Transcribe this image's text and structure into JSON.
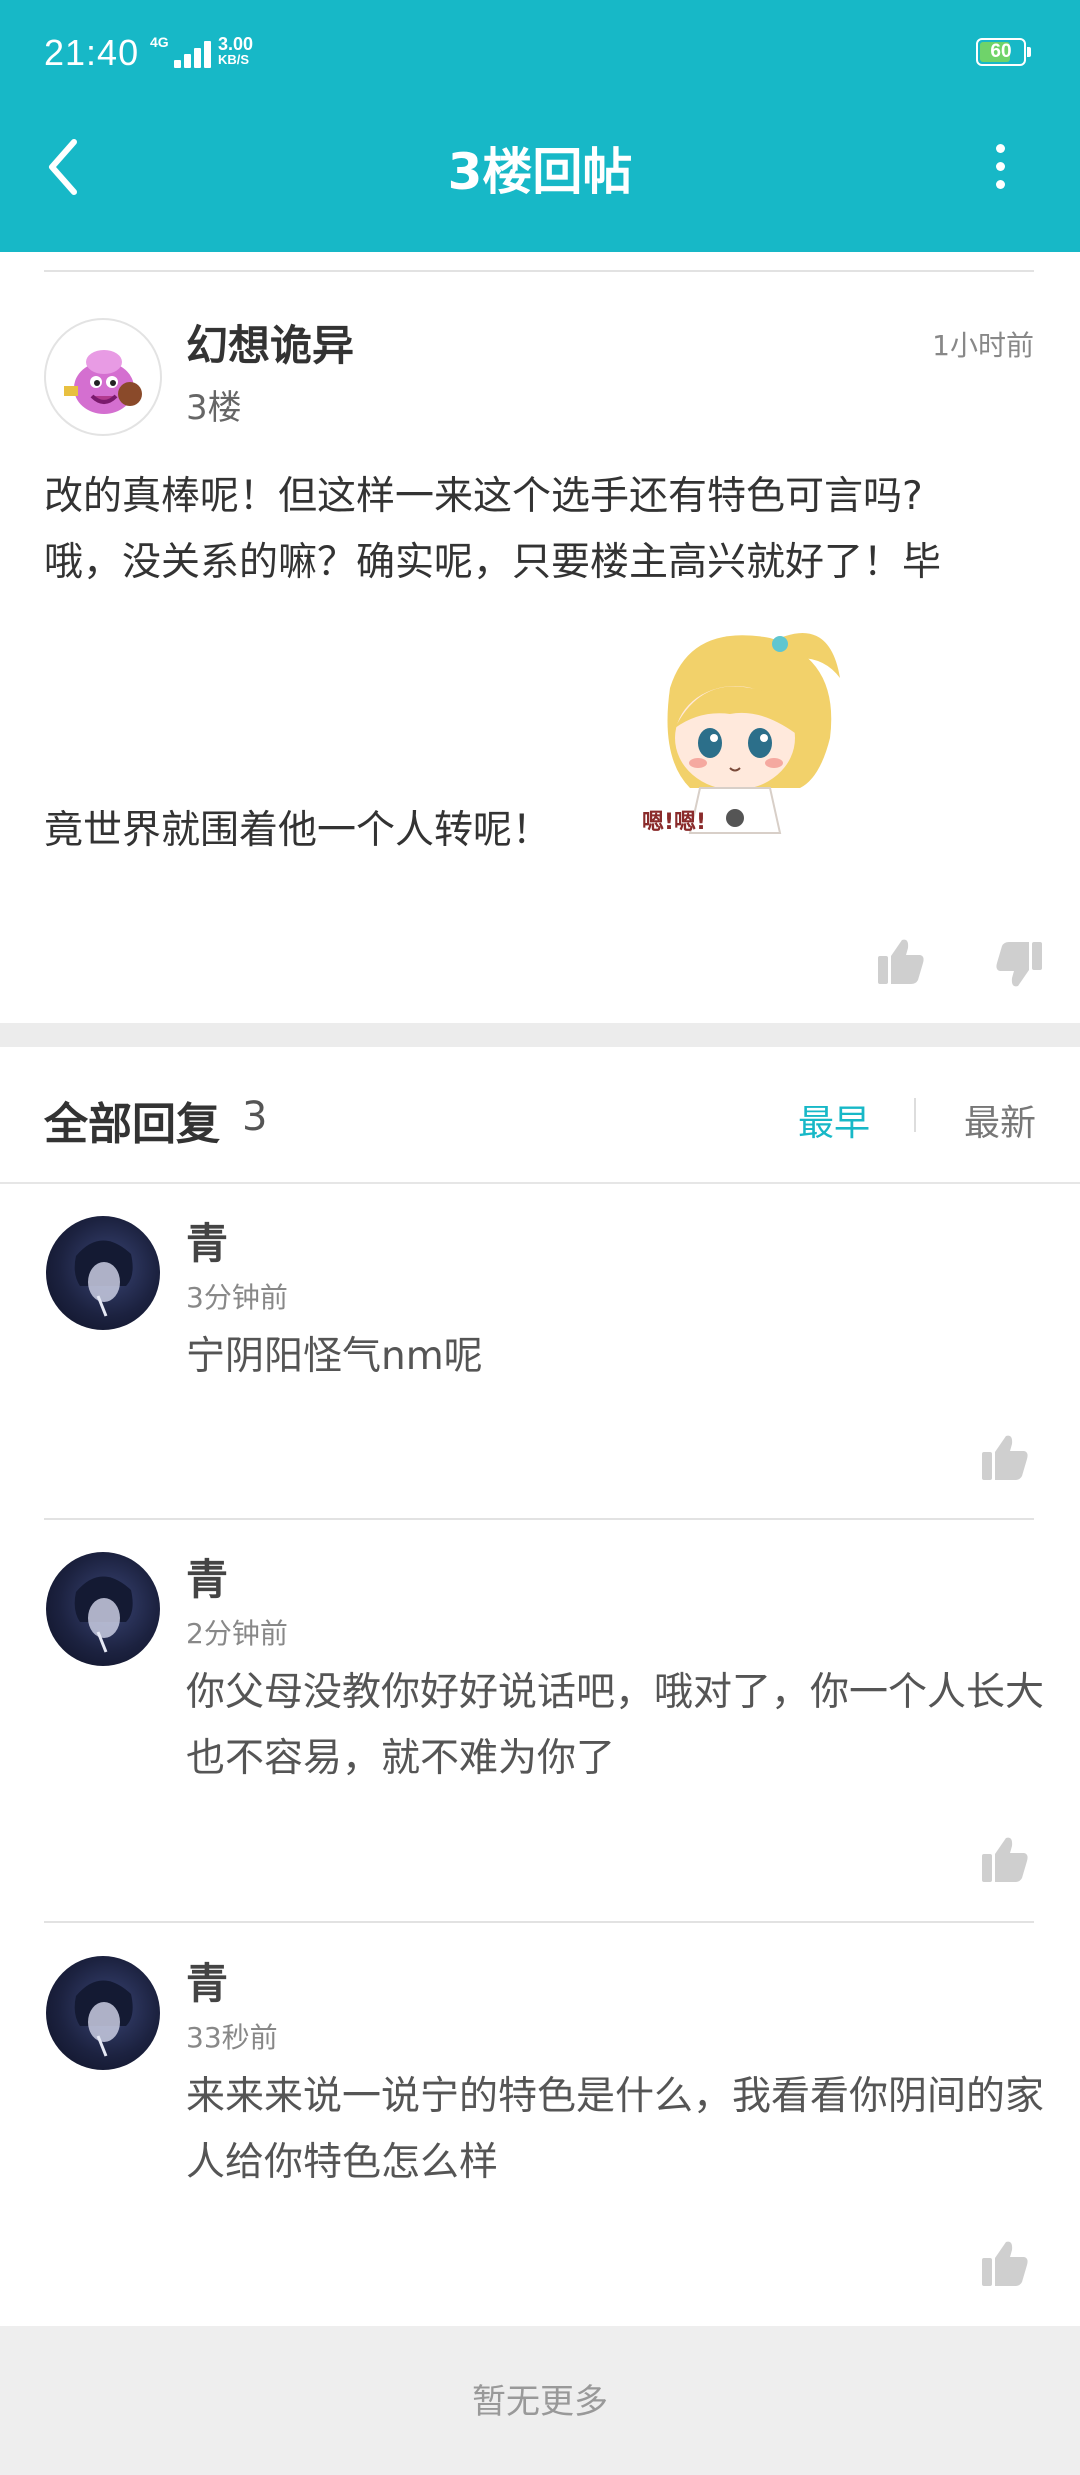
{
  "status_bar": {
    "time": "21:40",
    "network": "4G",
    "speed": "3.00",
    "speed_unit": "KB/S",
    "battery": "60"
  },
  "header": {
    "title": "3楼回帖",
    "back_icon": "chevron-left-icon",
    "more_icon": "more-vertical-icon",
    "bg_color": "#17b8c7"
  },
  "post": {
    "author": "幻想诡异",
    "floor": "3楼",
    "time": "1小时前",
    "lines": [
      "改的真棒呢！但这样一来这个选手还有特色可言吗?",
      "哦，没关系的嘛？确实呢，只要楼主高兴就好了！毕",
      "竟世界就围着他一个人转呢！"
    ],
    "sticker_text": "嗯!嗯!"
  },
  "replies_header": {
    "title": "全部回复",
    "count": "3",
    "sort_earliest": "最早",
    "sort_latest": "最新"
  },
  "replies": [
    {
      "name": "青",
      "time": "3分钟前",
      "text": "宁阴阳怪气nm呢"
    },
    {
      "name": "青",
      "time": "2分钟前",
      "text": "你父母没教你好好说话吧，哦对了，你一个人长大也不容易，就不难为你了"
    },
    {
      "name": "青",
      "time": "33秒前",
      "text": "来来来说一说宁的特色是什么，我看看你阴间的家人给你特色怎么样"
    }
  ],
  "footer": {
    "text": "暂无更多"
  }
}
